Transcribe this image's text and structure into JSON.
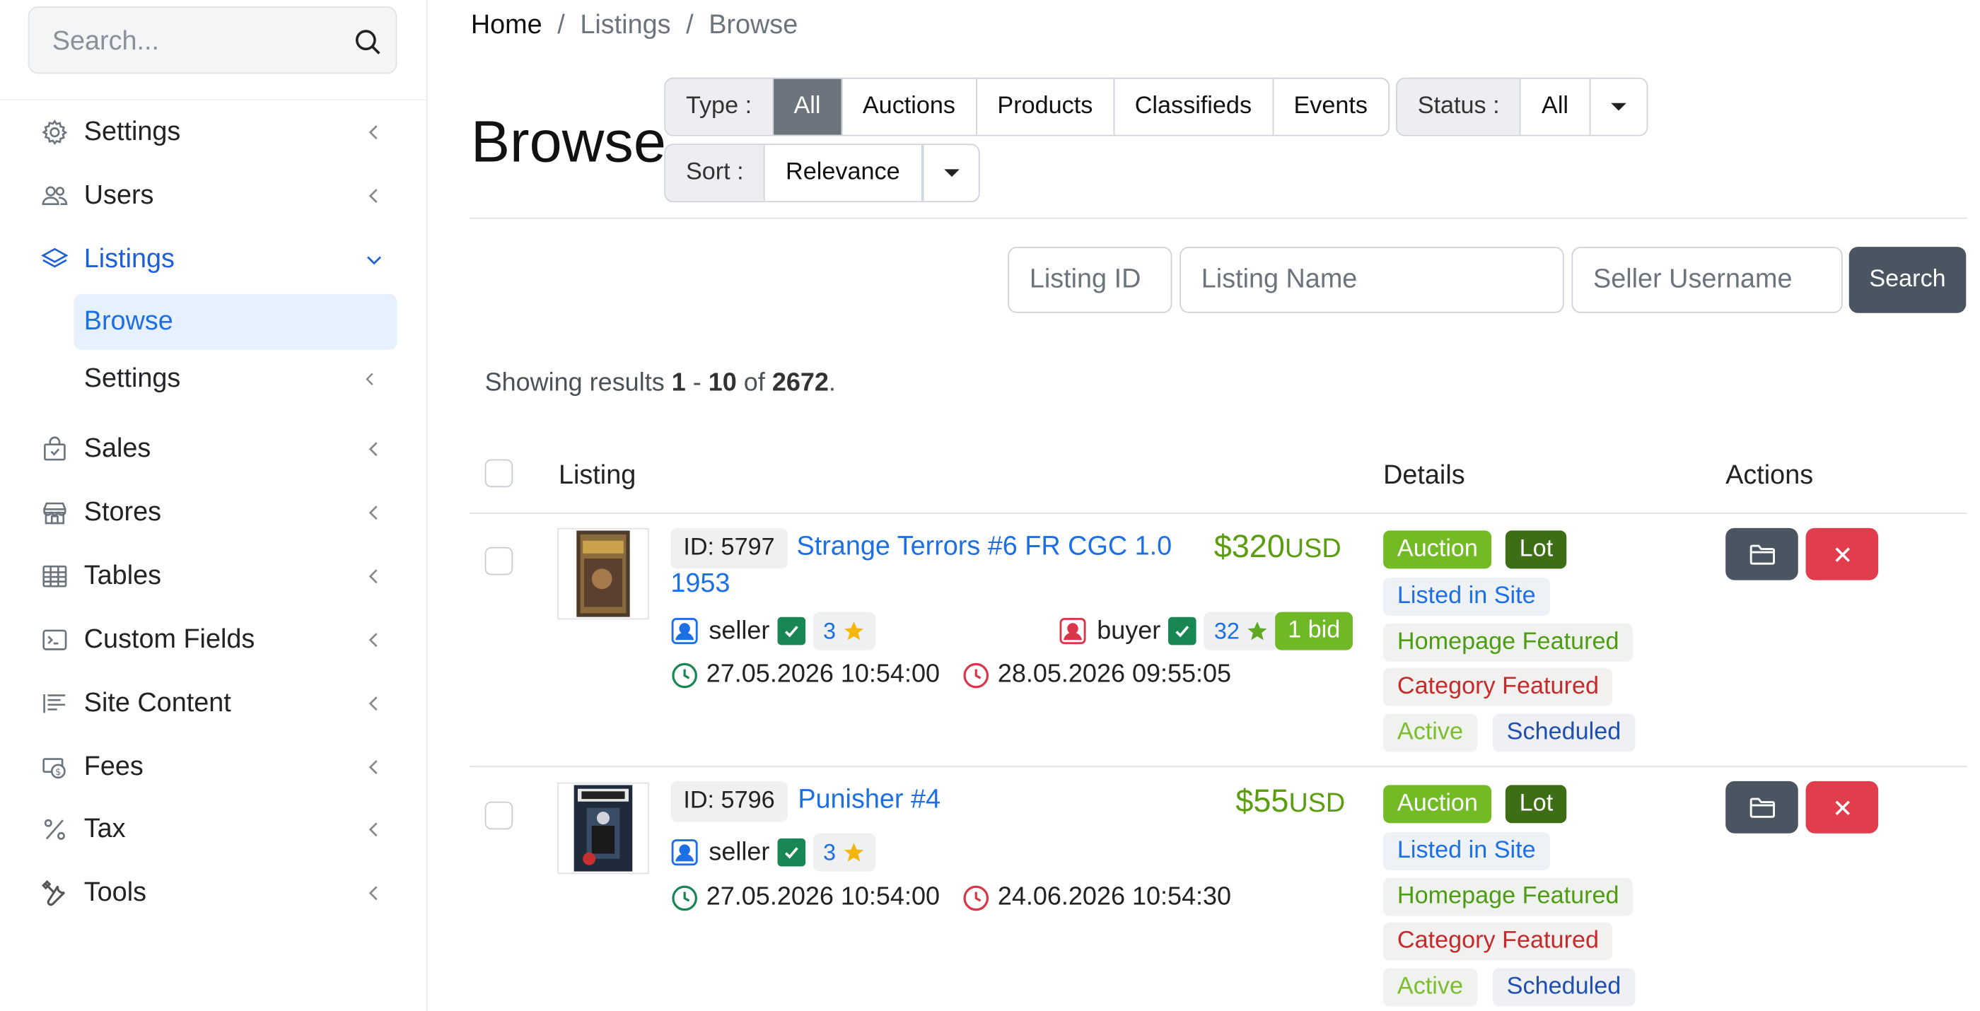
{
  "sidebar": {
    "search_placeholder": "Search...",
    "items": [
      {
        "label": "Settings",
        "icon": "gear-icon"
      },
      {
        "label": "Users",
        "icon": "users-icon"
      },
      {
        "label": "Listings",
        "icon": "layers-icon",
        "expanded": true
      },
      {
        "label": "Sales",
        "icon": "shopping-bag-icon"
      },
      {
        "label": "Stores",
        "icon": "store-icon"
      },
      {
        "label": "Tables",
        "icon": "table-icon"
      },
      {
        "label": "Custom Fields",
        "icon": "terminal-icon"
      },
      {
        "label": "Site Content",
        "icon": "text-lines-icon"
      },
      {
        "label": "Fees",
        "icon": "fees-icon"
      },
      {
        "label": "Tax",
        "icon": "percent-icon"
      },
      {
        "label": "Tools",
        "icon": "tools-icon"
      }
    ],
    "sub_items": [
      {
        "label": "Browse",
        "active": true
      },
      {
        "label": "Settings"
      }
    ],
    "accent_color": "#1e5fd6"
  },
  "breadcrumb": {
    "home": "Home",
    "sep": "/",
    "items": [
      "Listings",
      "Browse"
    ]
  },
  "page_title": "Browse",
  "filters": {
    "type": {
      "label": "Type :",
      "options": [
        "All",
        "Auctions",
        "Products",
        "Classifieds",
        "Events"
      ],
      "selected": "All"
    },
    "status": {
      "label": "Status :",
      "value": "All"
    },
    "sort": {
      "label": "Sort :",
      "value": "Relevance"
    }
  },
  "search_form": {
    "listing_id_placeholder": "Listing ID",
    "listing_name_placeholder": "Listing Name",
    "seller_placeholder": "Seller Username",
    "search_label": "Search"
  },
  "results": {
    "prefix": "Showing results",
    "from": "1",
    "dash": "-",
    "to": "10",
    "of": "of",
    "total": "2672",
    "suffix": "."
  },
  "table": {
    "headers": {
      "listing": "Listing",
      "details": "Details",
      "actions": "Actions"
    },
    "rows": [
      {
        "id": "ID: 5797",
        "title_line1": "Strange Terrors #6 FR CGC 1.0",
        "title_line2": "1953",
        "price": "$320",
        "currency": "USD",
        "seller": "seller",
        "seller_rating": "3",
        "buyer": "buyer",
        "buyer_rating": "32",
        "bids": "1 bid",
        "start": "27.05.2026 10:54:00",
        "end": "28.05.2026 09:55:05",
        "tags": [
          "Auction",
          "Lot",
          "Listed in Site",
          "Homepage Featured",
          "Category Featured",
          "Active",
          "Scheduled"
        ]
      },
      {
        "id": "ID: 5796",
        "title_line1": "Punisher #4",
        "price": "$55",
        "currency": "USD",
        "seller": "seller",
        "seller_rating": "3",
        "start": "27.05.2026 10:54:00",
        "end": "24.06.2026 10:54:30",
        "tags": [
          "Auction",
          "Lot",
          "Listed in Site",
          "Homepage Featured",
          "Category Featured",
          "Active",
          "Scheduled"
        ]
      }
    ]
  }
}
